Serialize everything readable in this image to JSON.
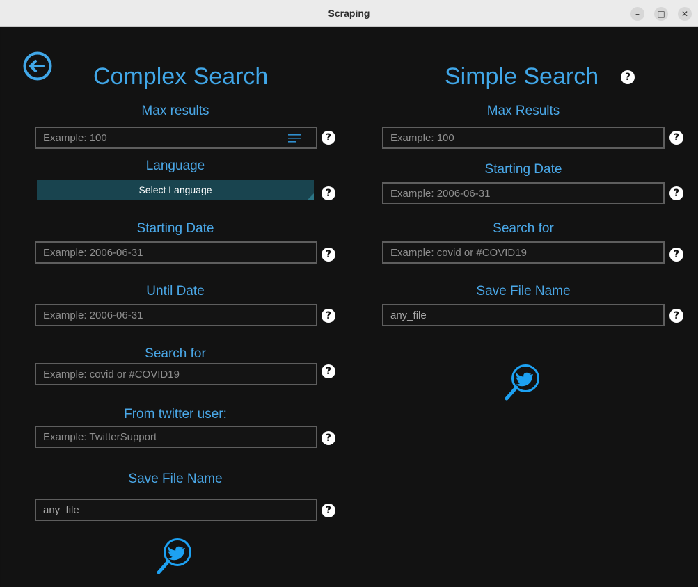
{
  "window": {
    "title": "Scraping"
  },
  "complex": {
    "heading": "Complex Search",
    "max_results": {
      "label": "Max results",
      "placeholder": "Example: 100"
    },
    "language": {
      "label": "Language",
      "button": "Select Language"
    },
    "starting_date": {
      "label": "Starting Date",
      "placeholder": "Example: 2006-06-31"
    },
    "until_date": {
      "label": "Until Date",
      "placeholder": "Example: 2006-06-31"
    },
    "search_for": {
      "label": "Search for",
      "placeholder": "Example: covid or #COVID19"
    },
    "from_user": {
      "label": "From twitter user:",
      "placeholder": "Example: TwitterSupport"
    },
    "save_file": {
      "label": "Save File Name",
      "value": "any_file"
    }
  },
  "simple": {
    "heading": "Simple Search",
    "max_results": {
      "label": "Max Results",
      "placeholder": "Example: 100"
    },
    "starting_date": {
      "label": "Starting Date",
      "placeholder": "Example: 2006-06-31"
    },
    "search_for": {
      "label": "Search for",
      "placeholder": "Example: covid or #COVID19"
    },
    "save_file": {
      "label": "Save File Name",
      "value": "any_file"
    }
  },
  "colors": {
    "accent": "#41a7e8",
    "button": "#19444f",
    "background": "#121212"
  },
  "icons": {
    "back": "back-arrow-icon",
    "help": "help-icon",
    "search": "twitter-search-icon"
  }
}
